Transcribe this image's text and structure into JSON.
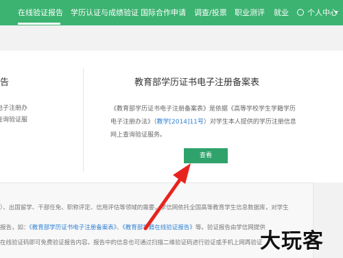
{
  "nav": {
    "items": [
      "在线验证报告",
      "学历认证与成绩验证",
      "国际合作申请",
      "调查/投票",
      "职业测评",
      "就业"
    ],
    "user_label": "个人中心"
  },
  "left_panel": {
    "title": "告",
    "text_lines": [
      "学籍学历电子注册办",
      "信息网上查询验证服"
    ]
  },
  "right_panel": {
    "title": "教育部学历证书电子注册备案表",
    "desc_part1": "《教育部学历证书电子注册备案表》是依据《高等学校学生学籍学历电子注册办法》（",
    "desc_link": "教学[2014]11号",
    "desc_part2": "）对学生本人提供的学历注册信息网上查询验证服务。",
    "button_label": "查看"
  },
  "info": {
    "line1": "）、出国留学、干部任免、职称评定、信用评估等领域的需要，学信网依托全国高等教育学生信息数据库，对学生",
    "line2_a": "报告，如：",
    "line2_link1": "《教育部学历证书电子注册备案表》",
    "line2_b": "、",
    "line2_link2": "《教育部学籍在线验证报告》",
    "line2_c": "等。验证报告由学信网提供",
    "line3": "在线验证码即可免费验证报告内容。报告中的信息也可通过扫描二维验证码进行验证或手机上网再验证"
  },
  "watermark": "大玩客",
  "colors": {
    "nav_bg": "#3cb371",
    "button_bg": "#2fa36b",
    "link": "#2f7fd3",
    "arrow": "#e8231f"
  }
}
